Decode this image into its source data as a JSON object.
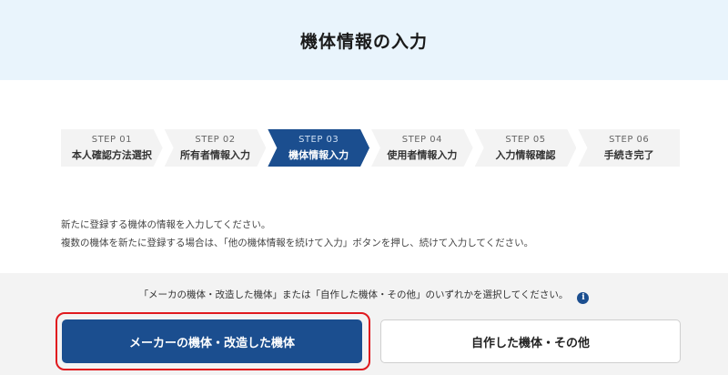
{
  "header": {
    "title": "機体情報の入力"
  },
  "steps": [
    {
      "num": "STEP 01",
      "label": "本人確認方法選択"
    },
    {
      "num": "STEP 02",
      "label": "所有者情報入力"
    },
    {
      "num": "STEP 03",
      "label": "機体情報入力"
    },
    {
      "num": "STEP 04",
      "label": "使用者情報入力"
    },
    {
      "num": "STEP 05",
      "label": "入力情報確認"
    },
    {
      "num": "STEP 06",
      "label": "手続き完了"
    }
  ],
  "active_step": 3,
  "description": {
    "line1": "新たに登録する機体の情報を入力してください。",
    "line2": "複数の機体を新たに登録する場合は、「他の機体情報を続けて入力」ボタンを押し、続けて入力してください。"
  },
  "selection": {
    "prompt": "「メーカの機体・改造した機体」または「自作した機体・その他」のいずれかを選択してください。",
    "info_icon": "i",
    "option_manufacturer": "メーカーの機体・改造した機体",
    "option_homemade": "自作した機体・その他"
  },
  "colors": {
    "accent": "#1b4e8f",
    "highlight": "#e0191e",
    "header_bg": "#e9f4fc"
  }
}
